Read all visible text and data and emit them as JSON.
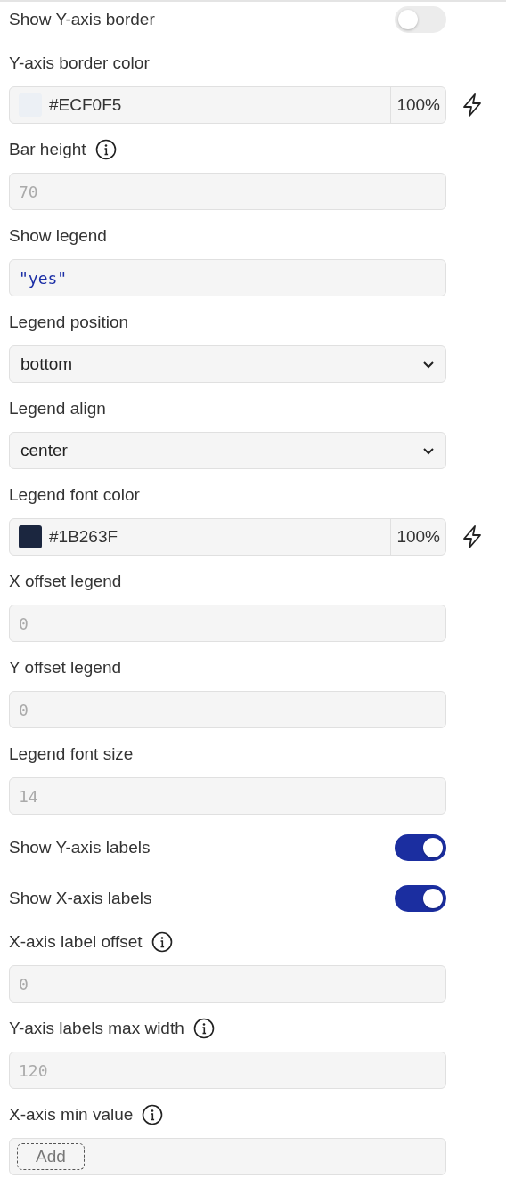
{
  "settings": [
    {
      "kind": "toggle",
      "label": "Show Y-axis border",
      "on": false
    },
    {
      "kind": "color",
      "label": "Y-axis border color",
      "color": "#ecf0f5",
      "value": "#ECF0F5",
      "opacity": "100%"
    },
    {
      "kind": "number",
      "label": "Bar height",
      "info": true,
      "placeholder": "70"
    },
    {
      "kind": "code",
      "label": "Show legend",
      "value": "\"yes\""
    },
    {
      "kind": "select",
      "label": "Legend position",
      "value": "bottom"
    },
    {
      "kind": "select",
      "label": "Legend align",
      "value": "center"
    },
    {
      "kind": "color",
      "label": "Legend font color",
      "color": "#1b263f",
      "value": "#1B263F",
      "opacity": "100%"
    },
    {
      "kind": "number",
      "label": "X offset legend",
      "info": false,
      "placeholder": "0"
    },
    {
      "kind": "number",
      "label": "Y offset legend",
      "info": false,
      "placeholder": "0"
    },
    {
      "kind": "number",
      "label": "Legend font size",
      "info": false,
      "placeholder": "14"
    },
    {
      "kind": "toggle",
      "label": "Show Y-axis labels",
      "on": true
    },
    {
      "kind": "toggle",
      "label": "Show X-axis labels",
      "on": true
    },
    {
      "kind": "number",
      "label": "X-axis label offset",
      "info": true,
      "placeholder": "0"
    },
    {
      "kind": "number",
      "label": "Y-axis labels max width",
      "info": true,
      "placeholder": "120"
    },
    {
      "kind": "add",
      "label": "X-axis min value",
      "info": true,
      "button": "Add"
    }
  ]
}
